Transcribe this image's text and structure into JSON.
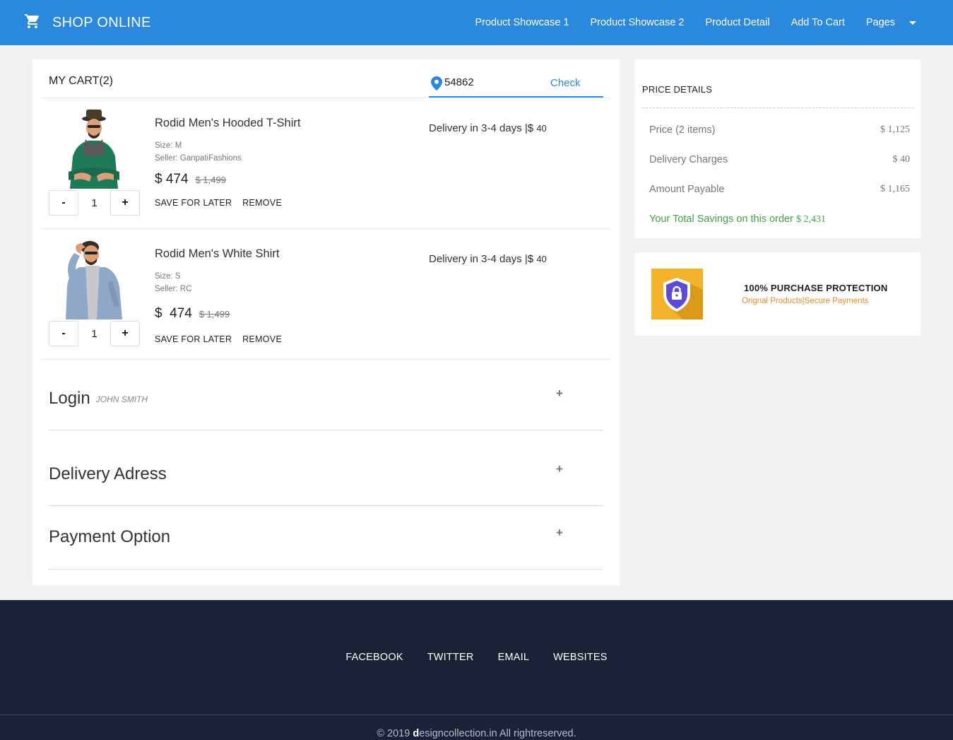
{
  "header": {
    "brand": "SHOP ONLINE",
    "brand_icon": "cart-icon",
    "nav": [
      "Product Showcase 1",
      "Product Showcase 2",
      "Product Detail",
      "Add To Cart",
      "Pages"
    ],
    "color": "#2a88dd"
  },
  "cart": {
    "title": "MY CART(2)",
    "pincode": "54862",
    "check_label": "Check",
    "items": [
      {
        "name": "Rodid Men's Hooded T-Shirt",
        "size": "Size: M",
        "seller": "Seller: GanpatiFashions",
        "currency": "$",
        "price": "474",
        "old_price": "$ 1,499",
        "quantity": "1",
        "minus": "-",
        "plus": "+",
        "save_label": "SAVE FOR LATER",
        "remove_label": "REMOVE",
        "delivery": "Delivery in 3-4 days",
        "delivery_sep": "|",
        "delivery_fee": "40"
      },
      {
        "name": "Rodid Men's White Shirt",
        "size": "Size: S",
        "seller": "Seller: RC",
        "currency": "$",
        "price": "474",
        "old_price": "$ 1,499",
        "quantity": "1",
        "minus": "-",
        "plus": "+",
        "save_label": "SAVE FOR LATER",
        "remove_label": "REMOVE",
        "delivery": "Delivery in 3-4 days",
        "delivery_sep": "|",
        "delivery_fee": "40"
      }
    ],
    "sections": [
      {
        "title": "Login",
        "subtitle": "JOHN SMITH",
        "toggle": "+"
      },
      {
        "title": "Delivery Adress",
        "toggle": "+"
      },
      {
        "title": "Payment Option",
        "toggle": "+"
      }
    ]
  },
  "price_details": {
    "title": "PRICE DETAILS",
    "rows": [
      {
        "label": "Price (2 items)",
        "currency": "$",
        "value": "1,125"
      },
      {
        "label": "Delivery Charges",
        "currency": "$",
        "value": "40"
      },
      {
        "label": "Amount Payable",
        "currency": "$",
        "value": "1,165"
      }
    ],
    "savings_label": "Your Total Savings on this order",
    "savings_currency": "$",
    "savings_value": "2,431",
    "savings_color": "#43a047"
  },
  "protection": {
    "icon": "shield-lock-icon",
    "title": "100% PURCHASE PROTECTION",
    "subtitle": "Orignal Products|Secure Payments",
    "accent": "#e08a2a"
  },
  "footer": {
    "links": [
      "FACEBOOK",
      "TWITTER",
      "EMAIL",
      "WEBSITES"
    ],
    "copyright_prefix": "© 2019 ",
    "copyright_bold": "d",
    "copyright_rest": "esigncollection.in All rightreserved.",
    "color": "#1a2238"
  }
}
